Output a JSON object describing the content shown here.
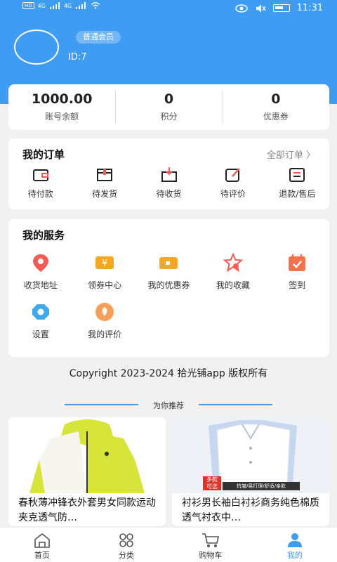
{
  "status_bar": {
    "time": "11:31",
    "hd1": "HD",
    "hd2": "HD",
    "sig1": "4G",
    "sig2": "4G"
  },
  "profile": {
    "member_level": "普通会员",
    "id_text": "ID:7"
  },
  "stats": [
    {
      "value": "1000.00",
      "label": "账号余额"
    },
    {
      "value": "0",
      "label": "积分"
    },
    {
      "value": "0",
      "label": "优惠券"
    }
  ],
  "orders": {
    "title": "我的订单",
    "all_link": "全部订单 〉",
    "items": [
      {
        "label": "待付款",
        "icon": "wallet-icon"
      },
      {
        "label": "待发货",
        "icon": "gift-box-icon"
      },
      {
        "label": "待收货",
        "icon": "receive-box-icon"
      },
      {
        "label": "待评价",
        "icon": "edit-icon"
      },
      {
        "label": "退款/售后",
        "icon": "list-icon"
      }
    ]
  },
  "services": {
    "title": "我的服务",
    "items": [
      {
        "label": "收货地址",
        "icon": "location-pin-icon"
      },
      {
        "label": "领券中心",
        "icon": "coupon-center-icon"
      },
      {
        "label": "我的优惠券",
        "icon": "coupon-card-icon"
      },
      {
        "label": "我的收藏",
        "icon": "star-icon"
      },
      {
        "label": "签到",
        "icon": "calendar-check-icon"
      },
      {
        "label": "设置",
        "icon": "settings-icon"
      },
      {
        "label": "我的评价",
        "icon": "review-icon"
      }
    ]
  },
  "copyright": "Copyright 2023-2024 拾光铺app 版权所有",
  "recommend": {
    "title": "为你推荐",
    "products": [
      {
        "name": "春秋薄冲锋衣外套男女同款运动夹克透气防…"
      },
      {
        "name": "衬衫男长袖白衬衫商务纯色棉质透气衬衣中…",
        "badge_top": "多款",
        "badge_bottom": "可选",
        "feature_text": "抗皱/易打理/舒适/亲肤"
      }
    ]
  },
  "tabbar": [
    {
      "label": "首页",
      "icon": "home-icon",
      "active": false
    },
    {
      "label": "分类",
      "icon": "category-icon",
      "active": false
    },
    {
      "label": "购物车",
      "icon": "cart-icon",
      "active": false
    },
    {
      "label": "我的",
      "icon": "user-icon",
      "active": true
    }
  ],
  "colors": {
    "primary": "#3f9cf3",
    "accent_red": "#f25c54",
    "accent_orange": "#f5a623"
  }
}
